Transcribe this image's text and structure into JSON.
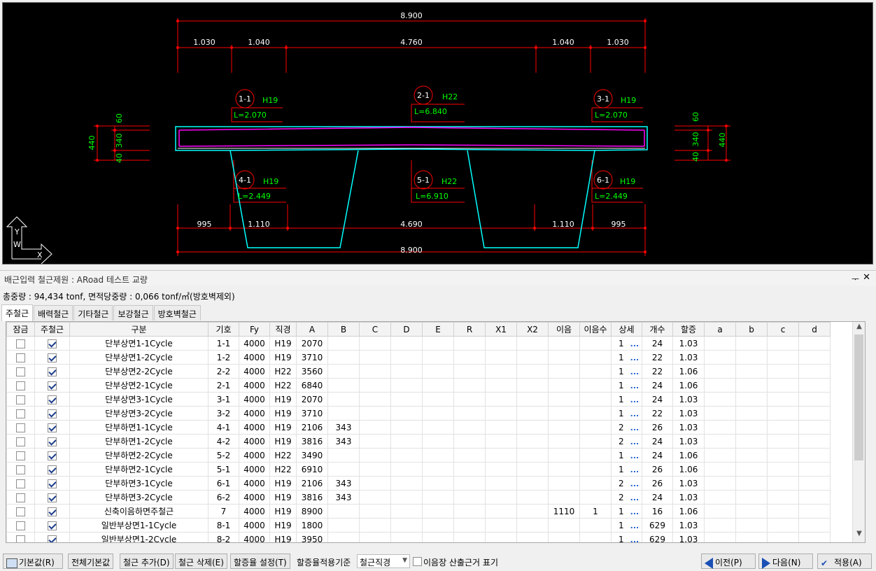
{
  "drawing": {
    "overall_top": "8.900",
    "top_dims": [
      "1.030",
      "1.040",
      "4.760",
      "1.040",
      "1.030"
    ],
    "bottom_dims": [
      "995",
      "1.110",
      "4.690",
      "1.110",
      "995"
    ],
    "overall_bottom": "8.900",
    "left_dims": {
      "total": "440",
      "a": "60",
      "b": "340",
      "c": "40"
    },
    "right_dims": {
      "total": "440",
      "a": "60",
      "b": "340",
      "c": "40"
    },
    "callouts": [
      {
        "id": "1-1",
        "bar": "H19",
        "len": "L=2.070"
      },
      {
        "id": "2-1",
        "bar": "H22",
        "len": "L=6.840"
      },
      {
        "id": "3-1",
        "bar": "H19",
        "len": "L=2.070"
      },
      {
        "id": "4-1",
        "bar": "H19",
        "len": "L=2.449"
      },
      {
        "id": "5-1",
        "bar": "H22",
        "len": "L=6.910"
      },
      {
        "id": "6-1",
        "bar": "H19",
        "len": "L=2.449"
      }
    ],
    "ucs": {
      "x": "X",
      "y": "Y",
      "w": "W"
    }
  },
  "panel": {
    "title": "배근입력 철근제원 : ARoad 테스트 교량",
    "pin": "ᅮ",
    "close": "✕"
  },
  "summary": "총중량 : 94,434 tonf, 면적당중량 : 0,066 tonf/㎡(방호벽제외)",
  "tabs": [
    "주철근",
    "배력철근",
    "기타철근",
    "보강철근",
    "방호벽철근"
  ],
  "grid": {
    "columns": [
      "잠금",
      "주철근",
      "구분",
      "기호",
      "Fy",
      "직경",
      "A",
      "B",
      "C",
      "D",
      "E",
      "R",
      "X1",
      "X2",
      "이음",
      "이음수",
      "상세",
      "개수",
      "할증",
      "a",
      "b",
      "c",
      "d"
    ],
    "rows": [
      {
        "lock": false,
        "main": true,
        "name": "단부상면1-1Cycle",
        "sym": "1-1",
        "fy": "4000",
        "dia": "H19",
        "A": "2070",
        "B": "",
        "joint": "",
        "jn": "",
        "detail": "1",
        "count": "24",
        "ext": "1.03"
      },
      {
        "lock": false,
        "main": true,
        "name": "단부상면1-2Cycle",
        "sym": "1-2",
        "fy": "4000",
        "dia": "H19",
        "A": "3710",
        "B": "",
        "joint": "",
        "jn": "",
        "detail": "1",
        "count": "22",
        "ext": "1.03"
      },
      {
        "lock": false,
        "main": true,
        "name": "단부상면2-2Cycle",
        "sym": "2-2",
        "fy": "4000",
        "dia": "H22",
        "A": "3560",
        "B": "",
        "joint": "",
        "jn": "",
        "detail": "1",
        "count": "22",
        "ext": "1.06"
      },
      {
        "lock": false,
        "main": true,
        "name": "단부상면2-1Cycle",
        "sym": "2-1",
        "fy": "4000",
        "dia": "H22",
        "A": "6840",
        "B": "",
        "joint": "",
        "jn": "",
        "detail": "1",
        "count": "24",
        "ext": "1.06"
      },
      {
        "lock": false,
        "main": true,
        "name": "단부상면3-1Cycle",
        "sym": "3-1",
        "fy": "4000",
        "dia": "H19",
        "A": "2070",
        "B": "",
        "joint": "",
        "jn": "",
        "detail": "1",
        "count": "24",
        "ext": "1.03"
      },
      {
        "lock": false,
        "main": true,
        "name": "단부상면3-2Cycle",
        "sym": "3-2",
        "fy": "4000",
        "dia": "H19",
        "A": "3710",
        "B": "",
        "joint": "",
        "jn": "",
        "detail": "1",
        "count": "22",
        "ext": "1.03"
      },
      {
        "lock": false,
        "main": true,
        "name": "단부하면1-1Cycle",
        "sym": "4-1",
        "fy": "4000",
        "dia": "H19",
        "A": "2106",
        "B": "343",
        "joint": "",
        "jn": "",
        "detail": "2",
        "count": "26",
        "ext": "1.03"
      },
      {
        "lock": false,
        "main": true,
        "name": "단부하면1-2Cycle",
        "sym": "4-2",
        "fy": "4000",
        "dia": "H19",
        "A": "3816",
        "B": "343",
        "joint": "",
        "jn": "",
        "detail": "2",
        "count": "24",
        "ext": "1.03"
      },
      {
        "lock": false,
        "main": true,
        "name": "단부하면2-2Cycle",
        "sym": "5-2",
        "fy": "4000",
        "dia": "H22",
        "A": "3490",
        "B": "",
        "joint": "",
        "jn": "",
        "detail": "1",
        "count": "24",
        "ext": "1.06"
      },
      {
        "lock": false,
        "main": true,
        "name": "단부하면2-1Cycle",
        "sym": "5-1",
        "fy": "4000",
        "dia": "H22",
        "A": "6910",
        "B": "",
        "joint": "",
        "jn": "",
        "detail": "1",
        "count": "26",
        "ext": "1.06"
      },
      {
        "lock": false,
        "main": true,
        "name": "단부하면3-1Cycle",
        "sym": "6-1",
        "fy": "4000",
        "dia": "H19",
        "A": "2106",
        "B": "343",
        "joint": "",
        "jn": "",
        "detail": "2",
        "count": "26",
        "ext": "1.03"
      },
      {
        "lock": false,
        "main": true,
        "name": "단부하면3-2Cycle",
        "sym": "6-2",
        "fy": "4000",
        "dia": "H19",
        "A": "3816",
        "B": "343",
        "joint": "",
        "jn": "",
        "detail": "2",
        "count": "24",
        "ext": "1.03"
      },
      {
        "lock": false,
        "main": true,
        "name": "신축이음하면주철근",
        "sym": "7",
        "fy": "4000",
        "dia": "H19",
        "A": "8900",
        "B": "",
        "joint": "1110",
        "jn": "1",
        "detail": "1",
        "count": "16",
        "ext": "1.06"
      },
      {
        "lock": false,
        "main": true,
        "name": "일반부상면1-1Cycle",
        "sym": "8-1",
        "fy": "4000",
        "dia": "H19",
        "A": "1800",
        "B": "",
        "joint": "",
        "jn": "",
        "detail": "1",
        "count": "629",
        "ext": "1.03"
      },
      {
        "lock": false,
        "main": true,
        "name": "일반부상면1-2Cycle",
        "sym": "8-2",
        "fy": "4000",
        "dia": "H19",
        "A": "3950",
        "B": "",
        "joint": "",
        "jn": "",
        "detail": "1",
        "count": "629",
        "ext": "1.03"
      }
    ],
    "detail_btn": "...",
    "scroll_up": "▲",
    "scroll_down": "▼"
  },
  "toolbar": {
    "default_btn": "기본값(R)",
    "all_default_btn": "전체기본값",
    "add_btn": "철근 추가(D)",
    "delete_btn": "철근 삭제(E)",
    "extra_btn": "할증율 설정(T)",
    "extra_basis_label": "할증율적용기준",
    "extra_basis_value": "철근직경",
    "joint_check_label": "이음장 산출근거 표기",
    "prev_btn": "이전(P)",
    "next_btn": "다음(N)",
    "apply_btn": "적용(A)"
  },
  "colors": {
    "cad_bg": "#000000",
    "dim": "#ff0000",
    "concrete": "#00ffff",
    "rebar": "#ff00ff",
    "text_green": "#00ff00",
    "arrow_blue": "#1a4fb5"
  }
}
